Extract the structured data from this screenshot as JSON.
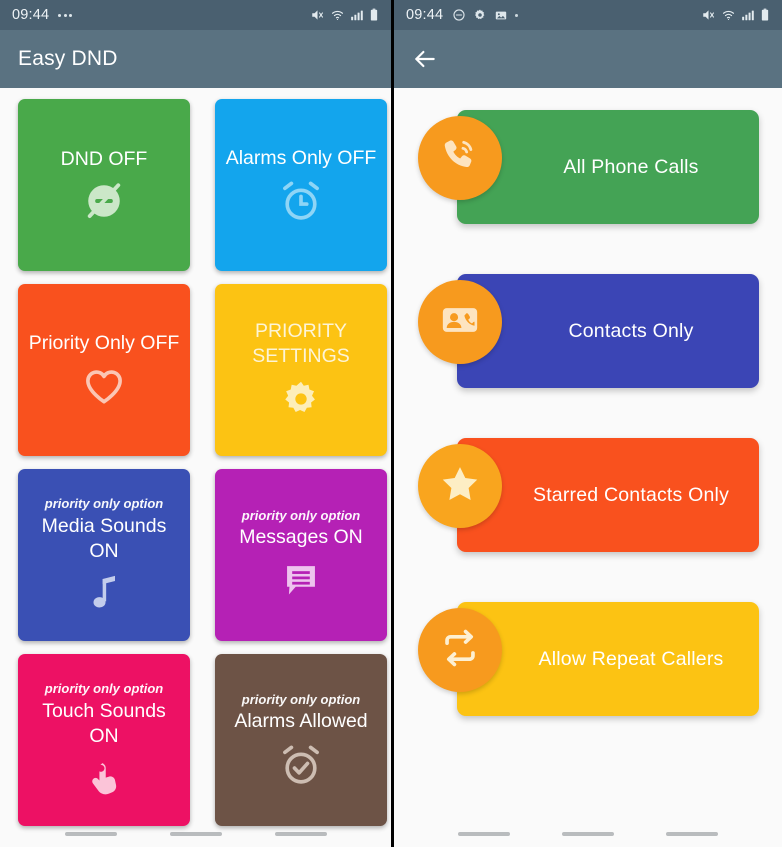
{
  "left_screen": {
    "status_bar": {
      "time": "09:44",
      "left_icons": [
        "more-dots-icon"
      ],
      "right_icons": [
        "mute-icon",
        "wifi-icon",
        "signal-bars-icon",
        "battery-icon"
      ]
    },
    "app_bar": {
      "title": "Easy DND"
    },
    "tiles": [
      {
        "label": "DND OFF",
        "sub": "",
        "icon": "dnd-off-icon",
        "color": "#49a94a",
        "text_color": "#ffffff",
        "icon_color": "#cbe7c8"
      },
      {
        "label": "Alarms Only OFF",
        "sub": "",
        "icon": "alarm-clock-icon",
        "color": "#13a5ed",
        "text_color": "#ffffff",
        "icon_color": "#8ed5f6"
      },
      {
        "label": "Priority Only OFF",
        "sub": "",
        "icon": "heart-icon",
        "color": "#f9511e",
        "text_color": "#ffffff",
        "icon_color": "#fbc6b4"
      },
      {
        "label": "PRIORITY SETTINGS",
        "sub": "",
        "icon": "gear-icon",
        "color": "#fcc313",
        "text_color": "#fdf4d6",
        "icon_color": "#fdeeb9"
      },
      {
        "label": "Media Sounds ON",
        "sub": "priority only option",
        "icon": "music-note-icon",
        "color": "#3a50b4",
        "text_color": "#ffffff",
        "icon_color": "#c3cdec"
      },
      {
        "label": "Messages ON",
        "sub": "priority only option",
        "icon": "message-bubble-icon",
        "color": "#b521b5",
        "text_color": "#ffffff",
        "icon_color": "#eec3ee"
      },
      {
        "label": "Touch Sounds ON",
        "sub": "priority only option",
        "icon": "touch-hand-icon",
        "color": "#ed1164",
        "text_color": "#ffffff",
        "icon_color": "#fbc4d8"
      },
      {
        "label": "Alarms Allowed",
        "sub": "priority only option",
        "icon": "alarm-check-icon",
        "color": "#6d5346",
        "text_color": "#ffffff",
        "icon_color": "#cdbdb2"
      }
    ],
    "nav_bar": {
      "pills": [
        "nav-recents-pill",
        "nav-home-pill",
        "nav-back-pill"
      ]
    }
  },
  "right_screen": {
    "status_bar": {
      "time": "09:44",
      "left_icons": [
        "dnd-minus-circle-icon",
        "gear-icon",
        "image-icon",
        "dot-icon"
      ],
      "right_icons": [
        "mute-icon",
        "wifi-icon",
        "signal-bars-icon",
        "battery-icon"
      ]
    },
    "app_bar": {
      "back_label": "back-arrow",
      "title": ""
    },
    "cards": [
      {
        "label": "All Phone Calls",
        "icon": "phone-call-icon",
        "bar_color": "#44a355",
        "circle_color": "#f79a1e",
        "icon_color": "#fde4c0"
      },
      {
        "label": "Contacts Only",
        "icon": "contact-card-icon",
        "bar_color": "#3b45b5",
        "circle_color": "#f79a1e",
        "icon_color": "#fde4c0"
      },
      {
        "label": "Starred Contacts Only",
        "icon": "star-icon",
        "bar_color": "#f9511e",
        "circle_color": "#f9a51e",
        "icon_color": "#fdeec4"
      },
      {
        "label": "Allow Repeat Callers",
        "icon": "repeat-icon",
        "bar_color": "#fcc313",
        "circle_color": "#f79a1e",
        "icon_color": "#fdf0d2"
      }
    ],
    "nav_bar": {
      "pills": [
        "nav-recents-pill",
        "nav-home-pill",
        "nav-back-pill"
      ]
    }
  },
  "colors": {
    "status_bar_bg": "#4a6070",
    "app_bar_bg": "#5a7281",
    "screen_bg": "#fafafa",
    "nav_pill": "#b9bcbe"
  }
}
